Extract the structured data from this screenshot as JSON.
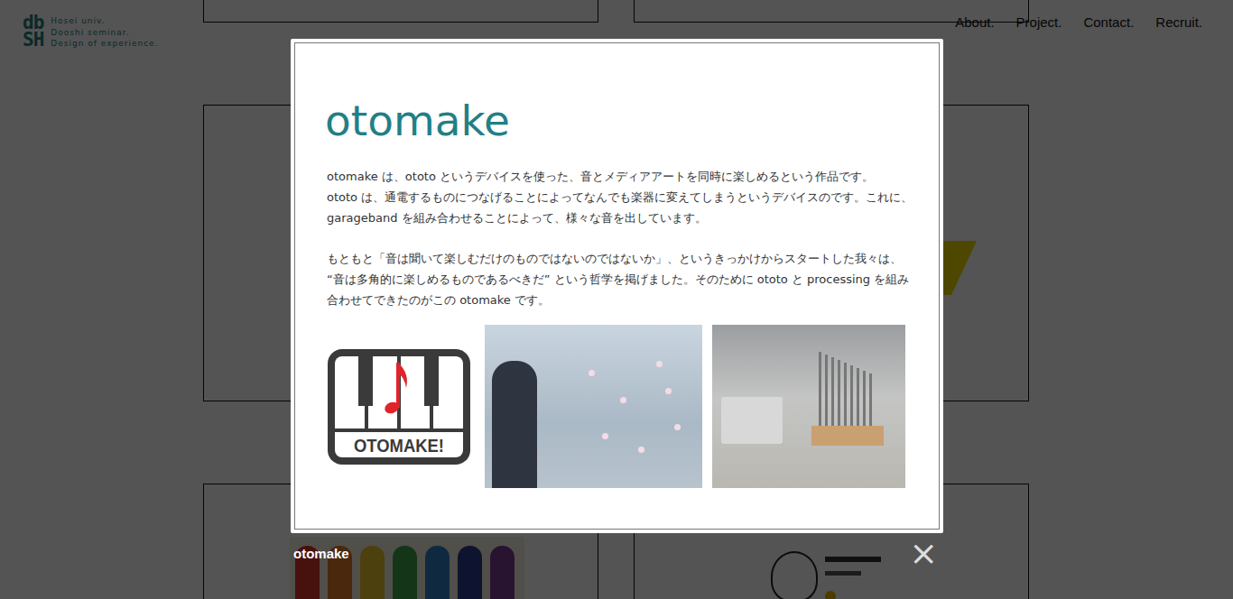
{
  "header": {
    "logo": {
      "mark": [
        "db",
        "SH"
      ],
      "lines": [
        "Hosei univ.",
        "Dooshi seminar.",
        "Design of experience."
      ]
    },
    "nav": [
      "About.",
      "Project.",
      "Contact.",
      "Recruit."
    ]
  },
  "lightbox": {
    "title": "otomake",
    "paragraphs": [
      [
        "otomake は、ototo というデバイスを使った、音とメディアアートを同時に楽しめるという作品です。",
        "ototo は、通電するものにつなげることによってなんでも楽器に変えてしまうというデバイスのです。これに、",
        "garageband を組み合わせることによって、様々な音を出しています。"
      ],
      [
        "もともと「音は聞いて楽しむだけのものではないのではないか」、というきっかけからスタートした我々は、",
        "“音は多角的に楽しめるものであるべきだ” という哲学を掲げました。そのために ototo と processing を組み",
        "合わせてできたのがこの otomake です。"
      ]
    ],
    "logo_text": "OTOMAKE!",
    "caption": "otomake",
    "close": "×"
  }
}
